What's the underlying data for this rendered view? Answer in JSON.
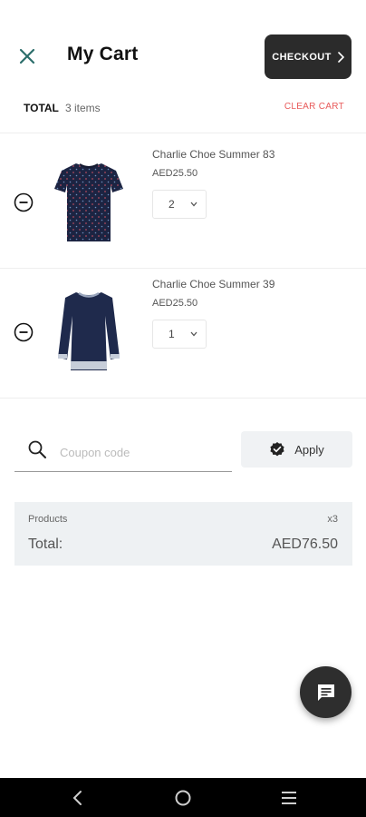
{
  "header": {
    "title": "My Cart",
    "checkout_label": "CHECKOUT"
  },
  "summary": {
    "total_label": "TOTAL",
    "items_count": "3 items",
    "clear_label": "CLEAR CART"
  },
  "items": [
    {
      "name": "Charlie Choe Summer 83",
      "price": "AED25.50",
      "qty": "2",
      "image": "navy-patterned-tshirt"
    },
    {
      "name": "Charlie Choe Summer 39",
      "price": "AED25.50",
      "qty": "1",
      "image": "navy-long-sleeve-top"
    }
  ],
  "coupon": {
    "placeholder": "Coupon code",
    "value": "",
    "apply_label": "Apply"
  },
  "totals": {
    "products_label": "Products",
    "products_count": "x3",
    "total_label": "Total:",
    "total_value": "AED76.50"
  },
  "colors": {
    "accent": "#2c6e6b",
    "clear_cart": "#e85a5a",
    "checkout_bg": "#2b2b2b",
    "totals_bg": "#eef1f3"
  },
  "icons": {
    "close": "close-icon",
    "checkout_arrow": "chevron-right-icon",
    "remove": "minus-circle-icon",
    "dropdown": "chevron-down-icon",
    "search": "search-icon",
    "apply": "check-badge-icon",
    "chat": "chat-icon",
    "nav_back": "back-icon",
    "nav_home": "home-icon",
    "nav_recents": "recents-icon"
  }
}
